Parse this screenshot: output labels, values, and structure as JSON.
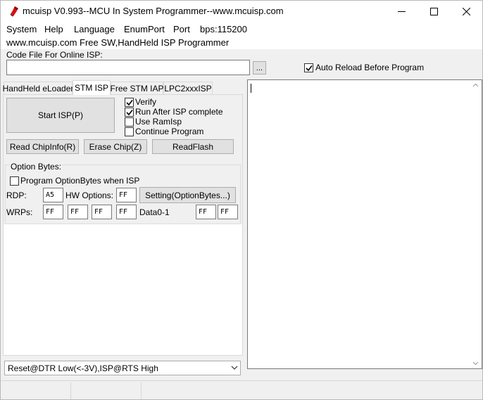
{
  "window": {
    "title": "mcuisp V0.993--MCU In System Programmer--www.mcuisp.com",
    "minimize_icon": "minimize-icon",
    "maximize_icon": "maximize-icon",
    "close_icon": "close-icon"
  },
  "menu": {
    "items": [
      "System",
      "Help",
      "Language",
      "EnumPort",
      "Port",
      "bps:115200"
    ]
  },
  "subtitle": "www.mcuisp.com Free SW,HandHeld ISP Programmer",
  "code_file": {
    "label": "Code File For Online ISP:",
    "value": "",
    "browse_label": "...",
    "auto_reload_label": "Auto Reload Before Program",
    "auto_reload_checked": true
  },
  "tabs": [
    {
      "label": "HandHeld eLoader",
      "active": false
    },
    {
      "label": "STM ISP",
      "active": true
    },
    {
      "label": "Free STM IAP",
      "active": false
    },
    {
      "label": "LPC2xxxISP",
      "active": false
    }
  ],
  "stm_isp": {
    "start_label": "Start ISP(P)",
    "options": [
      {
        "label": "Verify",
        "checked": true
      },
      {
        "label": "Run After ISP complete",
        "checked": true
      },
      {
        "label": "Use RamIsp",
        "checked": false
      },
      {
        "label": "Continue Program",
        "checked": false
      }
    ],
    "read_chipinfo_label": "Read ChipInfo(R)",
    "erase_chip_label": "Erase Chip(Z)",
    "read_flash_label": "ReadFlash",
    "option_bytes": {
      "group_label": "Option Bytes:",
      "program_label": "Program OptionBytes when ISP",
      "program_checked": false,
      "rdp_label": "RDP:",
      "rdp_value": "A5",
      "hw_label": "HW Options:",
      "hw_value": "FF",
      "setting_label": "Setting(OptionBytes...)",
      "wrps_label": "WRPs:",
      "wrps": [
        "FF",
        "FF",
        "FF",
        "FF"
      ],
      "data_label": "Data0-1",
      "data": [
        "FF",
        "FF"
      ]
    }
  },
  "reset_mode": {
    "selected": "Reset@DTR Low(<-3V),ISP@RTS High"
  },
  "log": {
    "text": ""
  }
}
